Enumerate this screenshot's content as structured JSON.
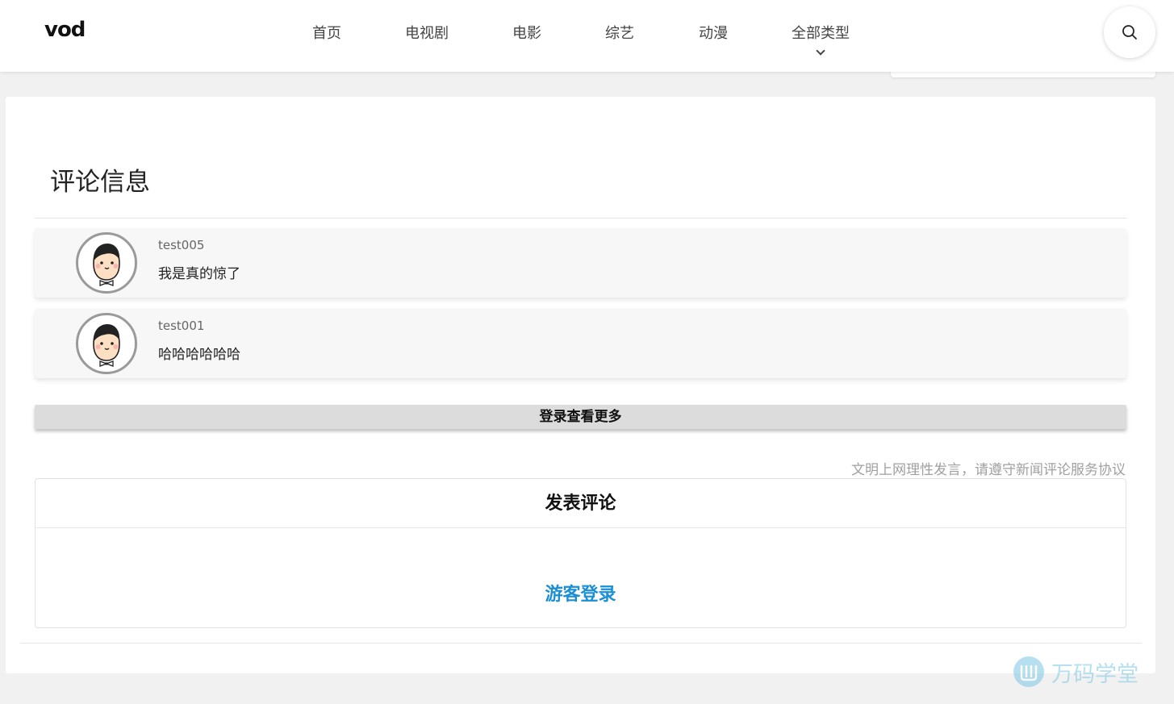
{
  "header": {
    "logo": "vod",
    "nav": [
      {
        "label": "首页"
      },
      {
        "label": "电视剧"
      },
      {
        "label": "电影"
      },
      {
        "label": "综艺"
      },
      {
        "label": "动漫"
      },
      {
        "label": "全部类型",
        "has_dropdown": true
      }
    ],
    "search_icon": "search-icon"
  },
  "comments_section": {
    "title": "评论信息",
    "comments": [
      {
        "user": "test005",
        "text": "我是真的惊了",
        "avatar_icon": "cartoon-boy-avatar"
      },
      {
        "user": "test001",
        "text": "哈哈哈哈哈哈",
        "avatar_icon": "cartoon-boy-avatar"
      }
    ],
    "more_button": "登录查看更多",
    "notice": "文明上网理性发言，请遵守新闻评论服务协议"
  },
  "post": {
    "title": "发表评论",
    "guest_login": "游客登录"
  },
  "watermark": {
    "text": "万码学堂"
  },
  "colors": {
    "accent_link": "#1a8fd6",
    "page_bg": "#f1f1f1",
    "comment_bg": "#f7f7f7",
    "more_button_bg": "#dcdcdc"
  }
}
